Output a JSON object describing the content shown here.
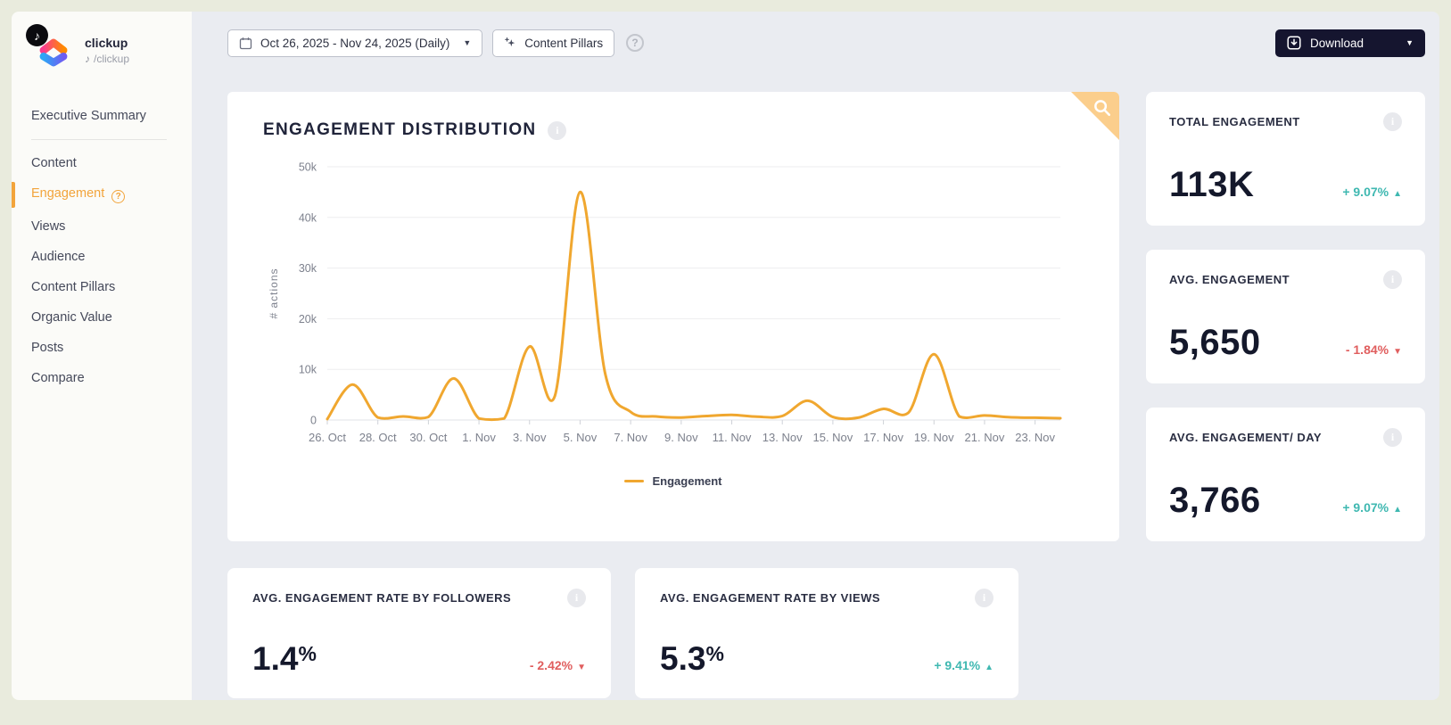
{
  "account": {
    "platform": "tiktok",
    "name": "clickup",
    "handle": "/clickup"
  },
  "sidebar": {
    "items": [
      {
        "label": "Executive Summary",
        "active": false
      },
      {
        "label": "Content",
        "active": false
      },
      {
        "label": "Engagement",
        "active": true,
        "help_badge": "?"
      },
      {
        "label": "Views",
        "active": false
      },
      {
        "label": "Audience",
        "active": false
      },
      {
        "label": "Content Pillars",
        "active": false
      },
      {
        "label": "Organic Value",
        "active": false
      },
      {
        "label": "Posts",
        "active": false
      },
      {
        "label": "Compare",
        "active": false
      }
    ]
  },
  "toolbar": {
    "date_range": "Oct 26, 2025 - Nov 24, 2025 (Daily)",
    "content_pillars": "Content Pillars",
    "help": "?",
    "download": "Download"
  },
  "chart_card": {
    "title": "ENGAGEMENT DISTRIBUTION",
    "legend": "Engagement"
  },
  "chart_data": {
    "type": "line",
    "title": "ENGAGEMENT DISTRIBUTION",
    "ylabel": "# actions",
    "ylim": [
      0,
      50000
    ],
    "yticks": [
      0,
      10000,
      20000,
      30000,
      40000,
      50000
    ],
    "ytick_labels": [
      "0",
      "10k",
      "20k",
      "30k",
      "40k",
      "50k"
    ],
    "x": [
      "Oct 26",
      "Oct 27",
      "Oct 28",
      "Oct 29",
      "Oct 30",
      "Oct 31",
      "Nov 1",
      "Nov 2",
      "Nov 3",
      "Nov 4",
      "Nov 5",
      "Nov 6",
      "Nov 7",
      "Nov 8",
      "Nov 9",
      "Nov 10",
      "Nov 11",
      "Nov 12",
      "Nov 13",
      "Nov 14",
      "Nov 15",
      "Nov 16",
      "Nov 17",
      "Nov 18",
      "Nov 19",
      "Nov 20",
      "Nov 21",
      "Nov 22",
      "Nov 23",
      "Nov 24"
    ],
    "xtick_labels": [
      "26. Oct",
      "28. Oct",
      "30. Oct",
      "1. Nov",
      "3. Nov",
      "5. Nov",
      "7. Nov",
      "9. Nov",
      "11. Nov",
      "13. Nov",
      "15. Nov",
      "17. Nov",
      "19. Nov",
      "21. Nov",
      "23. Nov"
    ],
    "xtick_every": 2,
    "grid": true,
    "legend_position": "bottom",
    "series": [
      {
        "name": "Engagement",
        "color": "#f0a72f",
        "values": [
          200,
          7000,
          500,
          700,
          600,
          8200,
          300,
          300,
          14500,
          4700,
          45000,
          9000,
          1600,
          700,
          500,
          800,
          1000,
          650,
          800,
          3800,
          600,
          450,
          2200,
          1500,
          13000,
          700,
          900,
          550,
          450,
          350
        ]
      }
    ]
  },
  "stat_cards": [
    {
      "label": "TOTAL ENGAGEMENT",
      "value": "113K",
      "delta": "+ 9.07%",
      "direction": "up"
    },
    {
      "label": "AVG. ENGAGEMENT",
      "value": "5,650",
      "delta": "- 1.84%",
      "direction": "down"
    },
    {
      "label": "AVG. ENGAGEMENT/ DAY",
      "value": "3,766",
      "delta": "+ 9.07%",
      "direction": "up"
    }
  ],
  "rate_cards": [
    {
      "label": "AVG. ENGAGEMENT RATE BY FOLLOWERS",
      "value": "1.4",
      "unit": "%",
      "delta": "- 2.42%",
      "direction": "down"
    },
    {
      "label": "AVG. ENGAGEMENT RATE BY VIEWS",
      "value": "5.3",
      "unit": "%",
      "delta": "+ 9.41%",
      "direction": "up"
    }
  ],
  "icons": {
    "trend_up": "▲",
    "trend_down": "▼",
    "dropdown_caret": "▼",
    "tiktok_note": "♪",
    "info": "i"
  },
  "colors": {
    "accent": "#f0a72f",
    "positive": "#3fb8b1",
    "negative": "#e05e5e",
    "download_bg": "#15152f",
    "corner": "#fbce8c"
  }
}
